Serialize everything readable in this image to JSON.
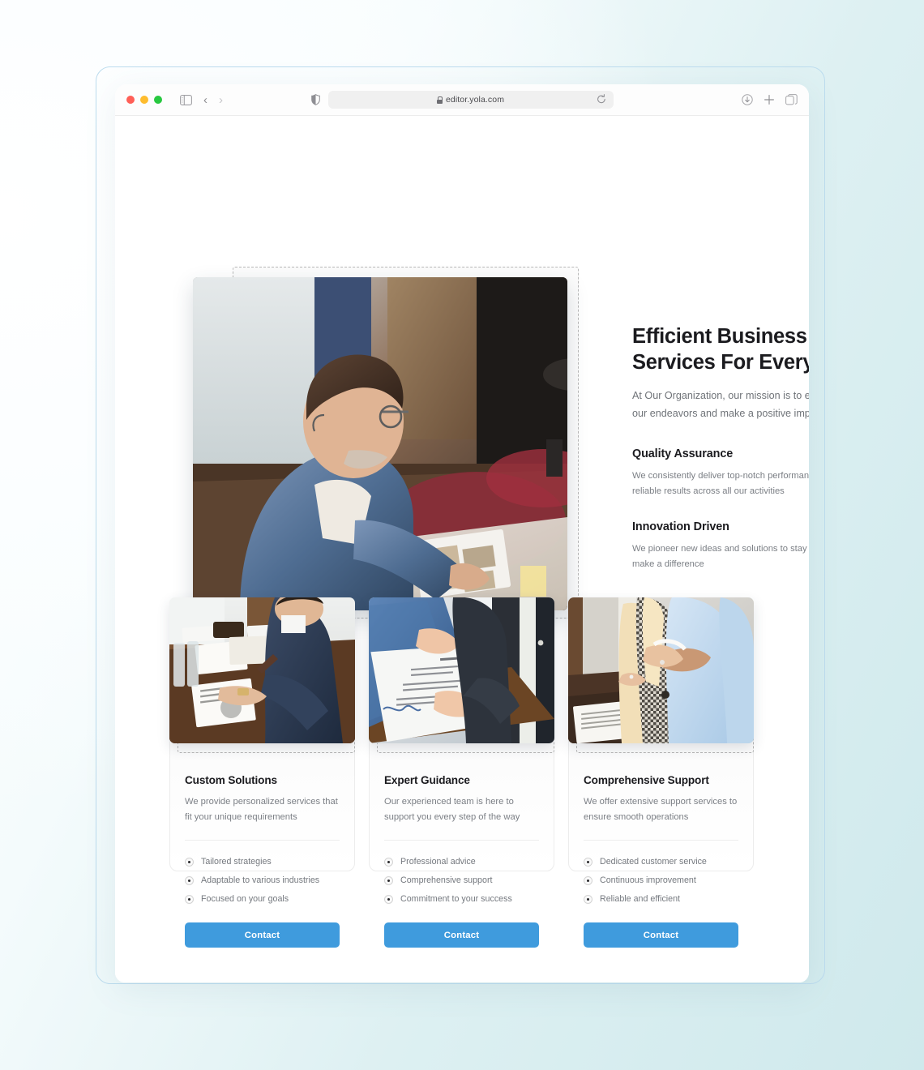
{
  "browser": {
    "url": "editor.yola.com",
    "traffic_lights": [
      "close-red",
      "minimize-yellow",
      "maximize-green"
    ],
    "icons": {
      "sidebar": "sidebar-toggle-icon",
      "back": "‹",
      "forward": "›",
      "shield": "shield-icon",
      "lock": "lock-icon",
      "reload": "reload-icon",
      "download": "download-icon",
      "new_tab": "plus-icon",
      "tab_overview": "tab-overview-icon"
    }
  },
  "hero": {
    "title": "Efficient Business Services For Every Need",
    "subtitle": "At Our Organization, our mission is to excel in all our endeavors and make a positive impact.",
    "features": [
      {
        "title": "Quality Assurance",
        "body": "We consistently deliver top-notch performance and reliable results across all our activities"
      },
      {
        "title": "Innovation Driven",
        "body": "We pioneer new ideas and solutions to stay ahead and make a difference"
      }
    ]
  },
  "cards": [
    {
      "title": "Custom Solutions",
      "desc": "We provide personalized services that fit your unique requirements",
      "items": [
        "Tailored strategies",
        "Adaptable to various industries",
        "Focused on your goals"
      ],
      "button": "Contact",
      "image_alt": "businessman-writing-at-desk"
    },
    {
      "title": "Expert Guidance",
      "desc": "Our experienced team is here to support you every step of the way",
      "items": [
        "Professional advice",
        "Comprehensive support",
        "Commitment to your success"
      ],
      "button": "Contact",
      "image_alt": "handing-over-signed-document"
    },
    {
      "title": "Comprehensive Support",
      "desc": "We offer extensive support services to ensure smooth operations",
      "items": [
        "Dedicated customer service",
        "Continuous improvement",
        "Reliable and efficient"
      ],
      "button": "Contact",
      "image_alt": "business-handshake-outdoors"
    }
  ],
  "colors": {
    "accent_blue": "#3f9bdd",
    "heading": "#1b1b1f",
    "body_text": "#7b7f85",
    "selection_dash": "#b5b5b5",
    "page_bg_start": "#ffffff",
    "page_bg_end": "#cfe9ec"
  }
}
